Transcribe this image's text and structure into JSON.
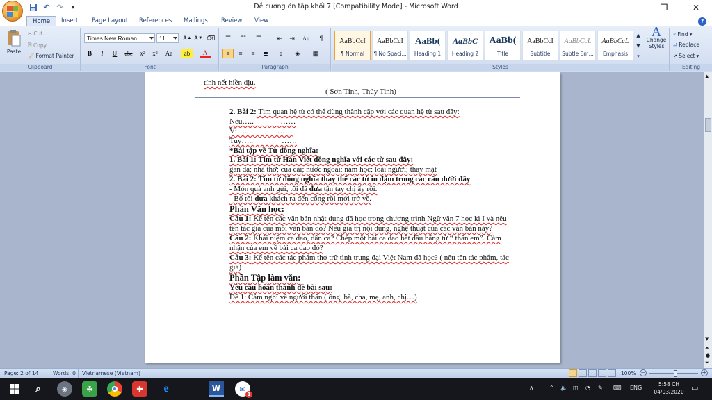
{
  "window": {
    "title": "Đề cương ôn tập khối 7 [Compatibility Mode] - Microsoft Word",
    "minimize_icon": "minimize-icon",
    "maximize_icon": "restore-icon",
    "close_icon": "close-icon"
  },
  "ribbon_tabs": [
    "Home",
    "Insert",
    "Page Layout",
    "References",
    "Mailings",
    "Review",
    "View"
  ],
  "active_tab": "Home",
  "clipboard": {
    "paste": "Paste",
    "cut": "Cut",
    "copy": "Copy",
    "format_painter": "Format Painter",
    "label": "Clipboard"
  },
  "font": {
    "family": "Times New Roman",
    "size": "11",
    "label": "Font"
  },
  "paragraph": {
    "label": "Paragraph"
  },
  "styles": {
    "label": "Styles",
    "items": [
      {
        "preview": "AaBbCcI",
        "name": "¶ Normal"
      },
      {
        "preview": "AaBbCcI",
        "name": "¶ No Spaci..."
      },
      {
        "preview": "AaBb(",
        "name": "Heading 1"
      },
      {
        "preview": "AaBbC",
        "name": "Heading 2"
      },
      {
        "preview": "AaBb(",
        "name": "Title"
      },
      {
        "preview": "AaBbCcI",
        "name": "Subtitle"
      },
      {
        "preview": "AaBbCcL",
        "name": "Subtle Em..."
      },
      {
        "preview": "AaBbCcL",
        "name": "Emphasis"
      }
    ],
    "change_styles": "Change Styles"
  },
  "editing": {
    "find": "Find",
    "replace": "Replace",
    "select": "Select",
    "label": "Editing"
  },
  "document": {
    "l0": "tính nết hiền dịu.",
    "l1": "( Sơn Tinh, Thủy Tinh)",
    "l2a": "2. Bài 2:",
    "l2b": " Tìm quan hệ từ có thể dùng thành cặp với các quan hệ từ sau đây:",
    "l3": "Nếu…..              ……",
    "l4": "Vì…..               ……",
    "l5": "Tuy…..               ……",
    "l6": "*Bài tập về Từ đồng nghĩa:",
    "l7": "1. Bài 1: Tìm từ Hán Việt đồng nghĩa với các từ sau đây:",
    "l8": "gan dạ; nhà thơ; của cải; nước ngoài; năm học; loài người; thay mặt",
    "l9": "2. Bài 2: Tìm từ đồng nghĩa thay thế các từ in đậm trong các câu dưới đây",
    "l10a": "- Món quà anh gửi, tôi đã ",
    "l10b": "đưa",
    "l10c": " tận tay chị ấy rồi.",
    "l11a": "- Bố tôi ",
    "l11b": "đưa",
    "l11c": " khách ra đến cổng rồi mới trở về.",
    "l12": " Phần Văn học:",
    "l13a": "Câu 1:",
    "l13b": " Kể tên các văn bản nhật dụng đã học trong chương trình Ngữ văn 7 học kì I và nêu",
    "l14": "tên tác giả của mỗi văn bản đó? Nêu giá trị nội dung, nghệ thuật của các văn bản này?",
    "l15a": "Câu 2:",
    "l15b": " Khái niệm ca dao, dân ca? Chép một bài ca dao bắt đầu bằng từ “ thân em”. Cảm",
    "l16": "nhận của em về bài ca dao đó?",
    "l17a": "Câu 3:",
    "l17b": " Kể tên các tác phẩm thơ trữ tình trung đại Việt Nam đã học? ( nêu tên tác phẩm, tác",
    "l18": "giả)",
    "l19": "Phần Tập làm văn:",
    "l20": "Yêu cầu hoàn thành đề bài sau:",
    "l21": "Đề 1: Cảm nghĩ về người thân ( ông, bà, cha, mẹ, anh, chị…)"
  },
  "statusbar": {
    "page": "Page: 2 of 14",
    "words": "Words: 0",
    "language": "Vietnamese (Vietnam)",
    "zoom": "100%",
    "zoom_fraction": 0.5
  },
  "taskbar": {
    "lang": "ENG",
    "time": "5:58 CH",
    "date": "04/03/2020",
    "badge": "1"
  },
  "colors": {
    "accent": "#2b63c4",
    "style_selected": "#e9a23c",
    "spell_underline": "#d22222"
  }
}
